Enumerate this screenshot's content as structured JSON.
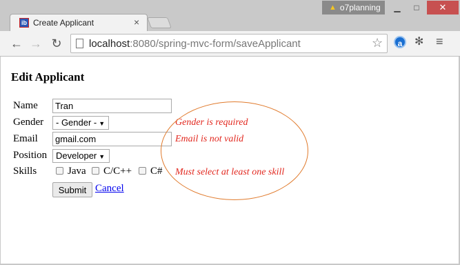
{
  "window": {
    "user_badge": "o7planning",
    "min_icon": "minimize-icon",
    "max_icon": "maximize-icon",
    "close_icon": "close-icon"
  },
  "tab": {
    "favicon_text": "ib",
    "title": "Create Applicant",
    "close_glyph": "×"
  },
  "toolbar": {
    "url_host": "localhost",
    "url_rest": ":8080/spring-mvc-form/saveApplicant",
    "back_glyph": "←",
    "forward_glyph": "→",
    "reload_glyph": "↻",
    "star_glyph": "☆",
    "ext_a_label": "a",
    "menu_glyph": "≡"
  },
  "form": {
    "heading": "Edit Applicant",
    "name_label": "Name",
    "name_value": "Tran",
    "gender_label": "Gender",
    "gender_selected": "- Gender -",
    "email_label": "Email",
    "email_value": "gmail.com",
    "position_label": "Position",
    "position_selected": "Developer",
    "skills_label": "Skills",
    "skills": [
      "Java",
      "C/C++",
      "C#"
    ],
    "submit_label": "Submit",
    "cancel_label": "Cancel"
  },
  "errors": {
    "gender": "Gender is required",
    "email": "Email is not valid",
    "skills": "Must select at least one skill"
  },
  "colors": {
    "error": "#e2281f",
    "highlight_ellipse": "#e07a2c",
    "link": "#0000ee"
  }
}
